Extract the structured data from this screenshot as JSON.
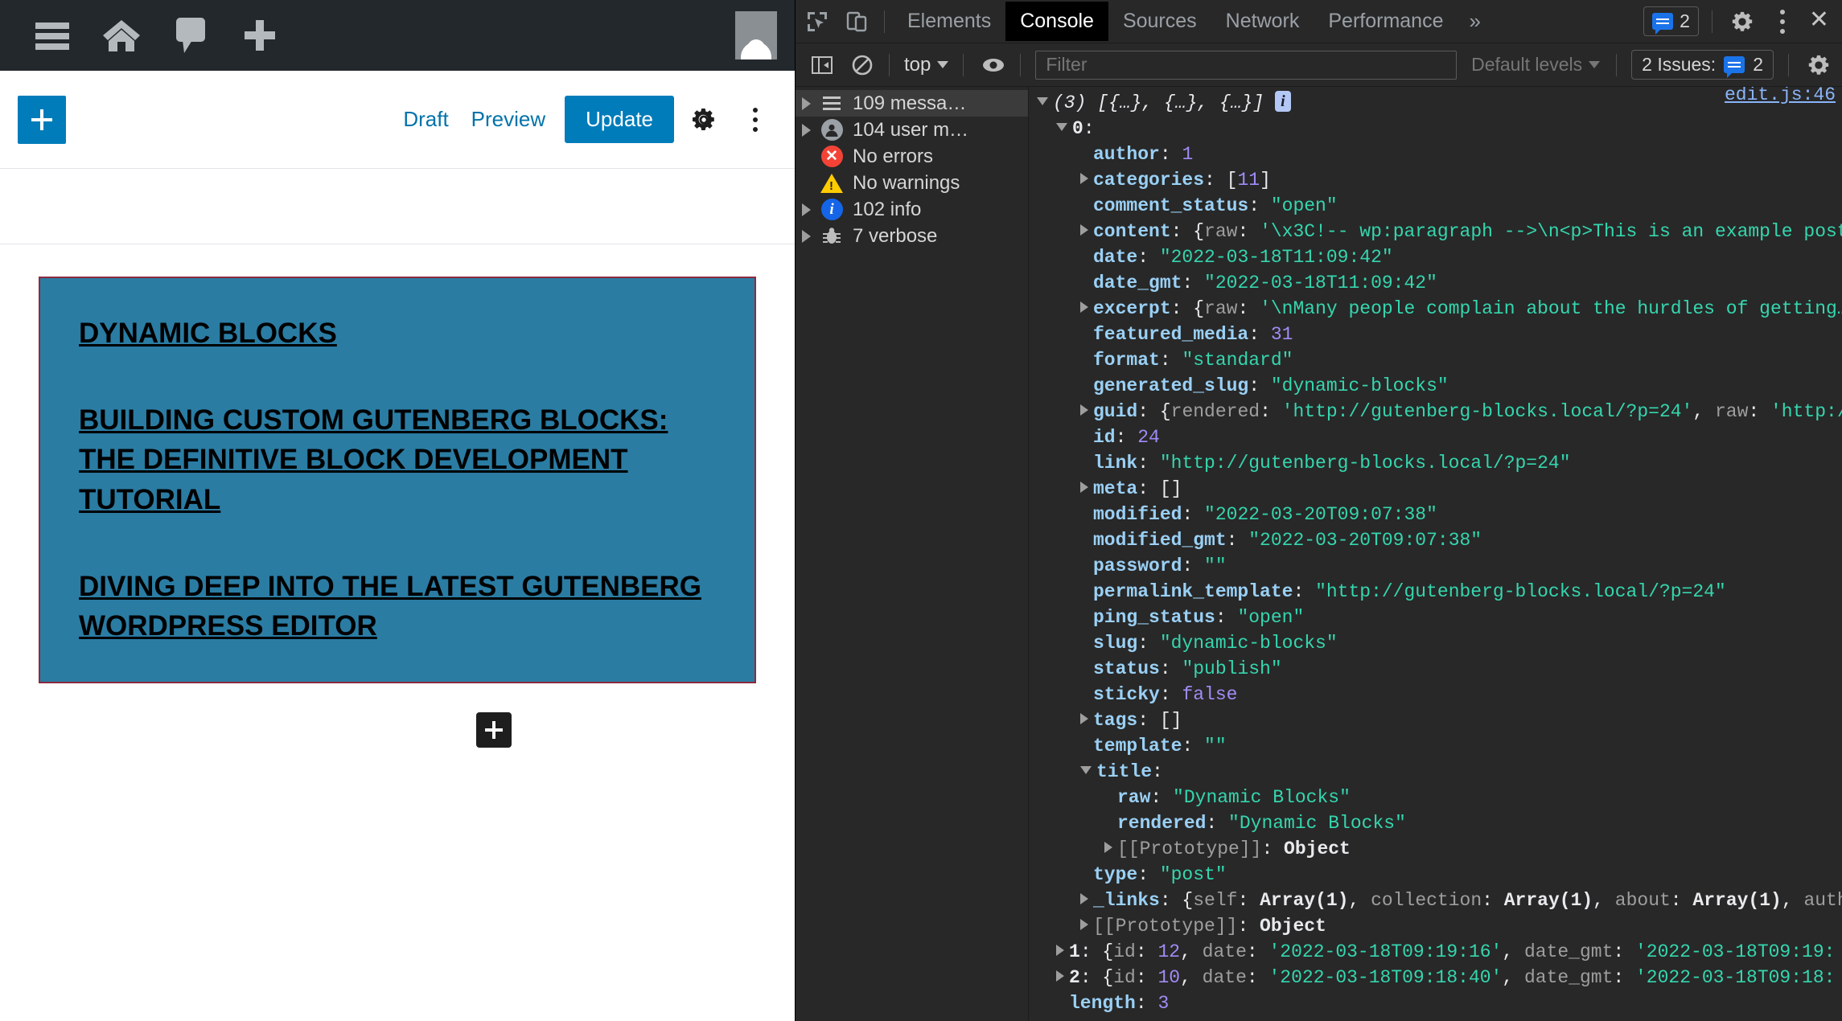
{
  "wordpress": {
    "adminbar": {
      "icons": [
        "menu-icon",
        "home-icon",
        "comment-icon",
        "new-content-icon"
      ],
      "avatar_name": "user-avatar"
    },
    "editor_toolbar": {
      "add_block_label": "+",
      "draft_label": "Draft",
      "preview_label": "Preview",
      "update_label": "Update",
      "settings_icon": "gear-icon",
      "options_icon": "kebab-menu-icon"
    },
    "block": {
      "background_color": "#2a7ca3",
      "border_color": "#8c2b3e",
      "posts": [
        "Dynamic Blocks",
        "Building Custom Gutenberg Blocks: The Definitive Block Development Tutorial",
        "Diving Deep into the Latest Gutenberg WordPress Editor"
      ]
    },
    "appender_label": "+"
  },
  "devtools": {
    "tabbar": {
      "inspect_icon": "inspect-element-icon",
      "device_icon": "device-toolbar-icon",
      "tabs": [
        {
          "label": "Elements",
          "active": false
        },
        {
          "label": "Console",
          "active": true
        },
        {
          "label": "Sources",
          "active": false
        },
        {
          "label": "Network",
          "active": false
        },
        {
          "label": "Performance",
          "active": false
        }
      ],
      "more_tabs_label": "»",
      "message_count": "2",
      "settings_icon": "gear-icon",
      "more_icon": "kebab-menu-icon",
      "close_label": "✕"
    },
    "filterbar": {
      "sidebar_toggle_icon": "console-sidebar-toggle-icon",
      "clear_icon": "clear-console-icon",
      "context_label": "top",
      "live_expression_icon": "eye-icon",
      "filter_placeholder": "Filter",
      "filter_value": "",
      "levels_label": "Default levels",
      "issues_label": "2 Issues:",
      "issues_count": "2",
      "console_settings_icon": "gear-icon"
    },
    "sidebar": [
      {
        "label": "109 messa…",
        "icon": "list-icon",
        "expandable": true,
        "selected": true
      },
      {
        "label": "104 user m…",
        "icon": "user-icon",
        "expandable": true,
        "selected": false
      },
      {
        "label": "No errors",
        "icon": "error-icon",
        "expandable": false,
        "selected": false
      },
      {
        "label": "No warnings",
        "icon": "warning-icon",
        "expandable": false,
        "selected": false
      },
      {
        "label": "102 info",
        "icon": "info-icon",
        "expandable": true,
        "selected": false
      },
      {
        "label": "7 verbose",
        "icon": "verbose-bug-icon",
        "expandable": true,
        "selected": false
      }
    ],
    "console": {
      "source_link": "edit.js:46",
      "lines": [
        {
          "indent": 0,
          "arrow": "down",
          "html": "<span class=\"ital\">(3) [{…}, {…}, {…}]</span> <span class=\"ibadge\">i</span>"
        },
        {
          "indent": 1,
          "arrow": "down",
          "html": "<span class=\"kbw\">0</span><span class=\"pl\">:</span>"
        },
        {
          "indent": 2,
          "arrow": "none",
          "html": "<span class=\"kb\">author</span><span class=\"pl\">: </span><span class=\"num\">1</span>"
        },
        {
          "indent": 2,
          "arrow": "right",
          "html": "<span class=\"kb\">categories</span><span class=\"pl\">: [</span><span class=\"num\">11</span><span class=\"pl\">]</span>"
        },
        {
          "indent": 2,
          "arrow": "none",
          "html": "<span class=\"kb\">comment_status</span><span class=\"pl\">: </span><span class=\"str\">\"open\"</span>"
        },
        {
          "indent": 2,
          "arrow": "right",
          "html": "<span class=\"kb\">content</span><span class=\"pl\">: {</span><span class=\"dim\">raw</span><span class=\"pl\">: </span><span class=\"str\">'\\x3C!-- wp:paragraph --&gt;\\n&lt;p&gt;This is an example post</span>"
        },
        {
          "indent": 2,
          "arrow": "none",
          "html": "<span class=\"kb\">date</span><span class=\"pl\">: </span><span class=\"str\">\"2022-03-18T11:09:42\"</span>"
        },
        {
          "indent": 2,
          "arrow": "none",
          "html": "<span class=\"kb\">date_gmt</span><span class=\"pl\">: </span><span class=\"str\">\"2022-03-18T11:09:42\"</span>"
        },
        {
          "indent": 2,
          "arrow": "right",
          "html": "<span class=\"kb\">excerpt</span><span class=\"pl\">: {</span><span class=\"dim\">raw</span><span class=\"pl\">: </span><span class=\"str\">'\\nMany people complain about the hurdles of getting…</span>"
        },
        {
          "indent": 2,
          "arrow": "none",
          "html": "<span class=\"kb\">featured_media</span><span class=\"pl\">: </span><span class=\"num\">31</span>"
        },
        {
          "indent": 2,
          "arrow": "none",
          "html": "<span class=\"kb\">format</span><span class=\"pl\">: </span><span class=\"str\">\"standard\"</span>"
        },
        {
          "indent": 2,
          "arrow": "none",
          "html": "<span class=\"kb\">generated_slug</span><span class=\"pl\">: </span><span class=\"str\">\"dynamic-blocks\"</span>"
        },
        {
          "indent": 2,
          "arrow": "right",
          "html": "<span class=\"kb\">guid</span><span class=\"pl\">: {</span><span class=\"dim\">rendered</span><span class=\"pl\">: </span><span class=\"str\">'http://gutenberg-blocks.local/?p=24'</span><span class=\"pl\">, </span><span class=\"dim\">raw</span><span class=\"pl\">: </span><span class=\"str\">'http:/</span>"
        },
        {
          "indent": 2,
          "arrow": "none",
          "html": "<span class=\"kb\">id</span><span class=\"pl\">: </span><span class=\"num\">24</span>"
        },
        {
          "indent": 2,
          "arrow": "none",
          "html": "<span class=\"kb\">link</span><span class=\"pl\">: </span><span class=\"str\">\"http://gutenberg-blocks.local/?p=24\"</span>"
        },
        {
          "indent": 2,
          "arrow": "right",
          "html": "<span class=\"kb\">meta</span><span class=\"pl\">: []</span>"
        },
        {
          "indent": 2,
          "arrow": "none",
          "html": "<span class=\"kb\">modified</span><span class=\"pl\">: </span><span class=\"str\">\"2022-03-20T09:07:38\"</span>"
        },
        {
          "indent": 2,
          "arrow": "none",
          "html": "<span class=\"kb\">modified_gmt</span><span class=\"pl\">: </span><span class=\"str\">\"2022-03-20T09:07:38\"</span>"
        },
        {
          "indent": 2,
          "arrow": "none",
          "html": "<span class=\"kb\">password</span><span class=\"pl\">: </span><span class=\"str\">\"\"</span>"
        },
        {
          "indent": 2,
          "arrow": "none",
          "html": "<span class=\"kb\">permalink_template</span><span class=\"pl\">: </span><span class=\"str\">\"http://gutenberg-blocks.local/?p=24\"</span>"
        },
        {
          "indent": 2,
          "arrow": "none",
          "html": "<span class=\"kb\">ping_status</span><span class=\"pl\">: </span><span class=\"str\">\"open\"</span>"
        },
        {
          "indent": 2,
          "arrow": "none",
          "html": "<span class=\"kb\">slug</span><span class=\"pl\">: </span><span class=\"str\">\"dynamic-blocks\"</span>"
        },
        {
          "indent": 2,
          "arrow": "none",
          "html": "<span class=\"kb\">status</span><span class=\"pl\">: </span><span class=\"str\">\"publish\"</span>"
        },
        {
          "indent": 2,
          "arrow": "none",
          "html": "<span class=\"kb\">sticky</span><span class=\"pl\">: </span><span class=\"bool\">false</span>"
        },
        {
          "indent": 2,
          "arrow": "right",
          "html": "<span class=\"kb\">tags</span><span class=\"pl\">: []</span>"
        },
        {
          "indent": 2,
          "arrow": "none",
          "html": "<span class=\"kb\">template</span><span class=\"pl\">: </span><span class=\"str\">\"\"</span>"
        },
        {
          "indent": 2,
          "arrow": "down",
          "html": "<span class=\"kb\">title</span><span class=\"pl\">:</span>"
        },
        {
          "indent": 3,
          "arrow": "none",
          "html": "<span class=\"kb\">raw</span><span class=\"pl\">: </span><span class=\"str\">\"Dynamic Blocks\"</span>"
        },
        {
          "indent": 3,
          "arrow": "none",
          "html": "<span class=\"kb\">rendered</span><span class=\"pl\">: </span><span class=\"str\">\"Dynamic Blocks\"</span>"
        },
        {
          "indent": 3,
          "arrow": "right",
          "html": "<span class=\"proto\">[[Prototype]]</span><span class=\"pl\">: </span><span class=\"kbw\">Object</span>"
        },
        {
          "indent": 2,
          "arrow": "none",
          "html": "<span class=\"kb\">type</span><span class=\"pl\">: </span><span class=\"str\">\"post\"</span>"
        },
        {
          "indent": 2,
          "arrow": "right",
          "html": "<span class=\"kb\">_links</span><span class=\"pl\">: {</span><span class=\"dim\">self</span><span class=\"pl\">: </span><span class=\"kbw\">Array(1)</span><span class=\"pl\">, </span><span class=\"dim\">collection</span><span class=\"pl\">: </span><span class=\"kbw\">Array(1)</span><span class=\"pl\">, </span><span class=\"dim\">about</span><span class=\"pl\">: </span><span class=\"kbw\">Array(1)</span><span class=\"pl\">, </span><span class=\"dim\">auth</span>"
        },
        {
          "indent": 2,
          "arrow": "right",
          "html": "<span class=\"proto\">[[Prototype]]</span><span class=\"pl\">: </span><span class=\"kbw\">Object</span>"
        },
        {
          "indent": 1,
          "arrow": "right",
          "html": "<span class=\"kbw\">1</span><span class=\"pl\">: {</span><span class=\"dim\">id</span><span class=\"pl\">: </span><span class=\"num\">12</span><span class=\"pl\">, </span><span class=\"dim\">date</span><span class=\"pl\">: </span><span class=\"str\">'2022-03-18T09:19:16'</span><span class=\"pl\">, </span><span class=\"dim\">date_gmt</span><span class=\"pl\">: </span><span class=\"str\">'2022-03-18T09:19:</span>"
        },
        {
          "indent": 1,
          "arrow": "right",
          "html": "<span class=\"kbw\">2</span><span class=\"pl\">: {</span><span class=\"dim\">id</span><span class=\"pl\">: </span><span class=\"num\">10</span><span class=\"pl\">, </span><span class=\"dim\">date</span><span class=\"pl\">: </span><span class=\"str\">'2022-03-18T09:18:40'</span><span class=\"pl\">, </span><span class=\"dim\">date_gmt</span><span class=\"pl\">: </span><span class=\"str\">'2022-03-18T09:18:</span>"
        },
        {
          "indent": 1,
          "arrow": "none",
          "html": "<span class=\"kb\">length</span><span class=\"pl\">: </span><span class=\"num\">3</span>"
        }
      ]
    }
  }
}
